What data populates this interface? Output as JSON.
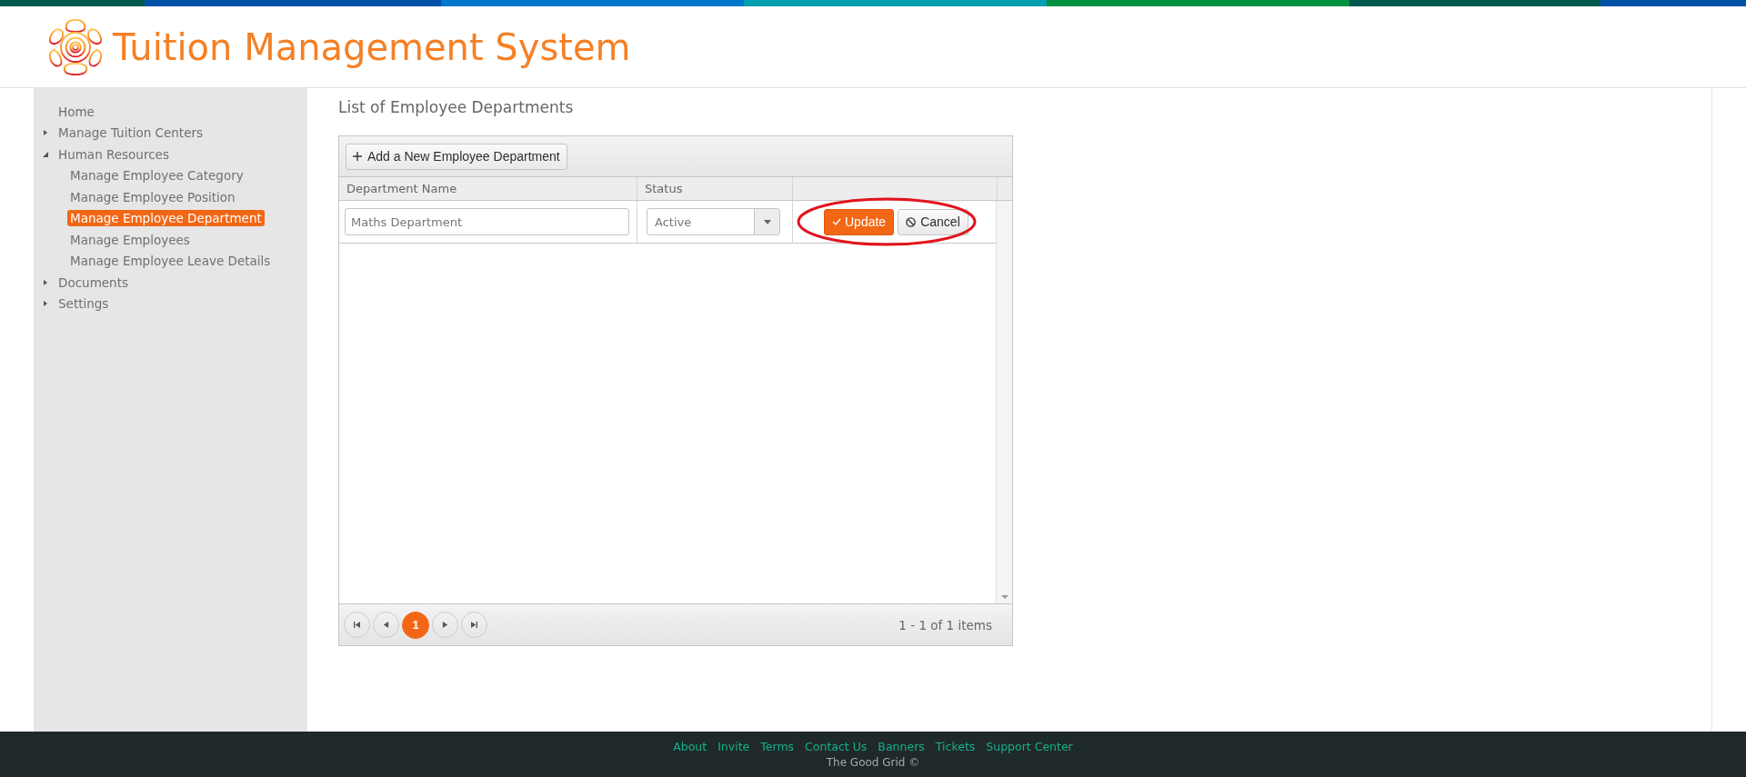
{
  "header": {
    "title": "Tuition Management System"
  },
  "sidebar": {
    "items": [
      {
        "label": "Home",
        "selected": false
      },
      {
        "label": "Manage Tuition Centers",
        "selected": false,
        "expanded": false
      },
      {
        "label": "Human Resources",
        "selected": false,
        "expanded": true,
        "children": [
          {
            "label": "Manage Employee Category",
            "selected": false
          },
          {
            "label": "Manage Employee Position",
            "selected": false
          },
          {
            "label": "Manage Employee Department",
            "selected": true
          },
          {
            "label": "Manage Employees",
            "selected": false
          },
          {
            "label": "Manage Employee Leave Details",
            "selected": false
          }
        ]
      },
      {
        "label": "Documents",
        "selected": false,
        "expanded": false
      },
      {
        "label": "Settings",
        "selected": false,
        "expanded": false
      }
    ]
  },
  "page_title": "List of Employee Departments",
  "grid": {
    "toolbar": {
      "add_button": "Add a New Employee Department"
    },
    "columns": [
      {
        "title": "Department Name"
      },
      {
        "title": "Status"
      }
    ],
    "edit_row": {
      "name_value": "Maths Department",
      "status_value": "Active",
      "update_button": "Update",
      "cancel_button": "Cancel",
      "highlighted": true
    },
    "pager": {
      "pages": [
        {
          "label": "1",
          "selected": true
        }
      ],
      "info": "1 - 1 of 1 items"
    }
  },
  "footer": {
    "links": [
      "About",
      "Invite",
      "Terms",
      "Contact Us",
      "Banners",
      "Tickets",
      "Support Center"
    ],
    "copyright": "The Good Grid ©"
  }
}
